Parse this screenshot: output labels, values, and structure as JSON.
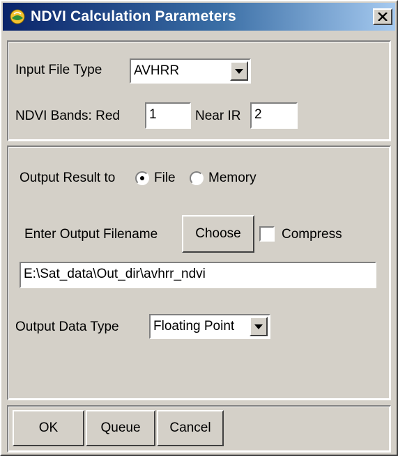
{
  "window": {
    "title": "NDVI Calculation Parameters"
  },
  "input": {
    "file_type_label": "Input File Type",
    "file_type_value": "AVHRR",
    "bands_label": "NDVI Bands: Red",
    "red_value": "1",
    "near_ir_label": "Near IR",
    "near_ir_value": "2"
  },
  "output": {
    "result_label": "Output Result to",
    "radio_file_label": "File",
    "radio_memory_label": "Memory",
    "selected_option": "File",
    "filename_label": "Enter Output Filename",
    "choose_label": "Choose",
    "compress_label": "Compress",
    "compress_checked": false,
    "filename_value": "E:\\Sat_data\\Out_dir\\avhrr_ndvi",
    "data_type_label": "Output Data Type",
    "data_type_value": "Floating Point"
  },
  "buttons": {
    "ok": "OK",
    "queue": "Queue",
    "cancel": "Cancel"
  },
  "icons": {
    "app": "globe-icon",
    "close": "close-icon",
    "dropdown": "chevron-down-icon"
  }
}
